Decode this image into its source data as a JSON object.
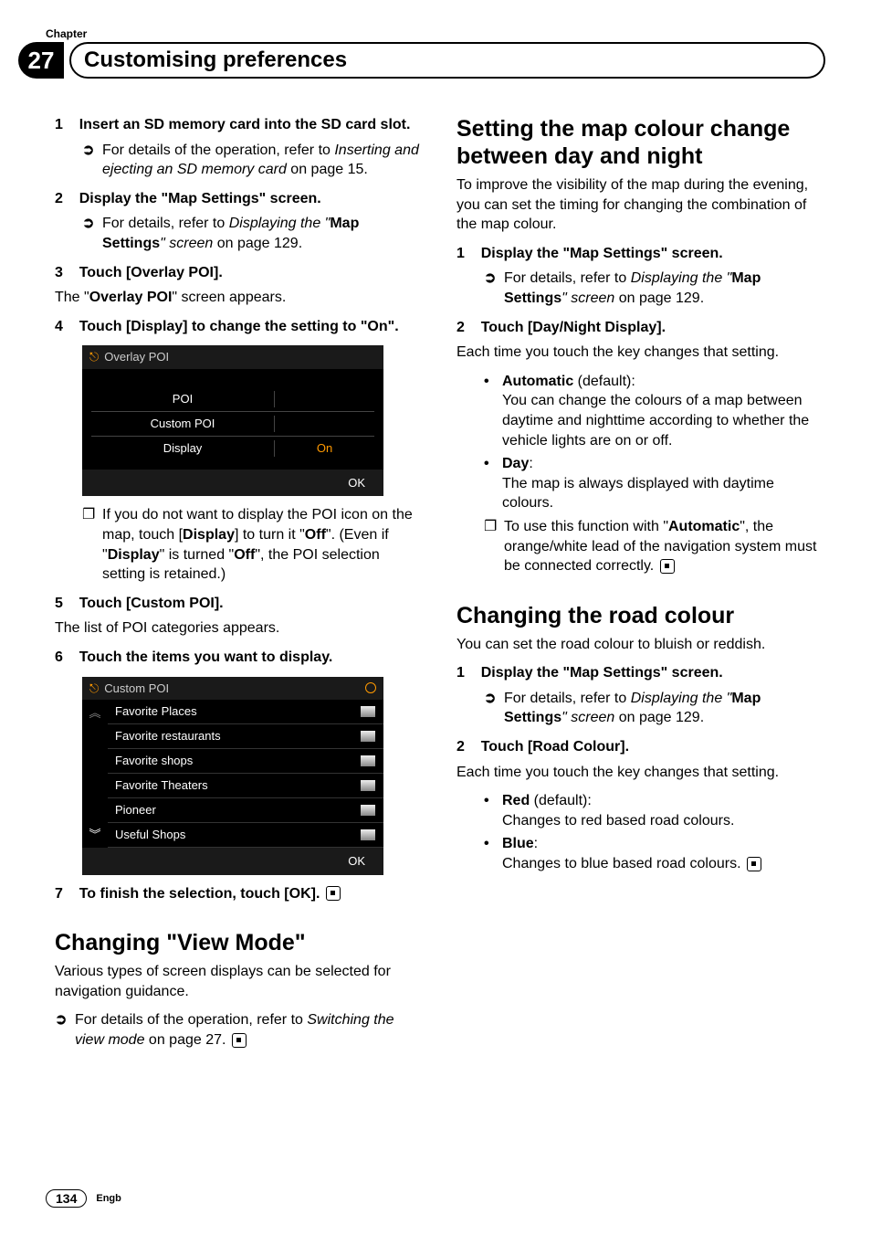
{
  "chapter_label": "Chapter",
  "chapter_number": "27",
  "chapter_title": "Customising preferences",
  "left": {
    "step1_num": "1",
    "step1_title": "Insert an SD memory card into the SD card slot.",
    "step1_note": "For details of the operation, refer to ",
    "step1_note_ital": "Inserting and ejecting an SD memory card",
    "step1_note_tail": " on page 15.",
    "step2_num": "2",
    "step2_title": "Display the \"Map Settings\" screen.",
    "step2_note_a": "For details, refer to ",
    "step2_note_ital": "Displaying the \"",
    "step2_note_bold": "Map Settings",
    "step2_note_ital2": "\" screen",
    "step2_note_tail": " on page 129.",
    "step3_num": "3",
    "step3_title": "Touch [Overlay POI].",
    "step3_body_a": "The \"",
    "step3_body_b": "Overlay POI",
    "step3_body_c": "\" screen appears.",
    "step4_num": "4",
    "step4_title": "Touch [Display] to change the setting to \"On\".",
    "ss1_title": "Overlay POI",
    "ss1_row1": "POI",
    "ss1_row2": "Custom POI",
    "ss1_row3": "Display",
    "ss1_row3_val": "On",
    "ss1_ok": "OK",
    "step4_sq_a": "If you do not want to display the POI icon on the map, touch [",
    "step4_sq_b": "Display",
    "step4_sq_c": "] to turn it \"",
    "step4_sq_d": "Off",
    "step4_sq_e": "\". (Even if \"",
    "step4_sq_f": "Display",
    "step4_sq_g": "\" is turned \"",
    "step4_sq_h": "Off",
    "step4_sq_i": "\", the POI selection setting is retained.)",
    "step5_num": "5",
    "step5_title": "Touch [Custom POI].",
    "step5_body": "The list of POI categories appears.",
    "step6_num": "6",
    "step6_title": "Touch the items you want to display.",
    "ss2_title": "Custom POI",
    "ss2_rows": [
      "Favorite Places",
      "Favorite restaurants",
      "Favorite shops",
      "Favorite Theaters",
      "Pioneer",
      "Useful Shops"
    ],
    "ss2_ok": "OK",
    "step7_num": "7",
    "step7_title": "To finish the selection, touch [OK].",
    "h2_viewmode": "Changing \"View Mode\"",
    "viewmode_p": "Various types of screen displays can be selected for navigation guidance.",
    "viewmode_note": "For details of the operation, refer to ",
    "viewmode_note_ital": "Switching the view mode",
    "viewmode_note_tail": " on page 27."
  },
  "right": {
    "h2_daynight": "Setting the map colour change between day and night",
    "daynight_p": "To improve the visibility of the map during the evening, you can set the timing for changing the combination of the map colour.",
    "dn_step1_num": "1",
    "dn_step1_title": "Display the \"Map Settings\" screen.",
    "dn_step1_note_a": "For details, refer to ",
    "dn_step1_note_ital": "Displaying the \"",
    "dn_step1_note_bold": "Map Settings",
    "dn_step1_note_ital2": "\" screen",
    "dn_step1_note_tail": " on page 129.",
    "dn_step2_num": "2",
    "dn_step2_title": "Touch [Day/Night Display].",
    "dn_step2_body": "Each time you touch the key changes that setting.",
    "dn_b1_label": "Automatic",
    "dn_b1_paren": " (default):",
    "dn_b1_body": "You can change the colours of a map between daytime and nighttime according to whether the vehicle lights are on or off.",
    "dn_b2_label": "Day",
    "dn_b2_colon": ":",
    "dn_b2_body": "The map is always displayed with daytime colours.",
    "dn_sq_a": "To use this function with \"",
    "dn_sq_b": "Automatic",
    "dn_sq_c": "\", the orange/white lead of the navigation system must be connected correctly.",
    "h2_road": "Changing the road colour",
    "road_p": "You can set the road colour to bluish or reddish.",
    "rc_step1_num": "1",
    "rc_step1_title": "Display the \"Map Settings\" screen.",
    "rc_step1_note_a": "For details, refer to ",
    "rc_step1_note_ital": "Displaying the \"",
    "rc_step1_note_bold": "Map Settings",
    "rc_step1_note_ital2": "\" screen",
    "rc_step1_note_tail": " on page 129.",
    "rc_step2_num": "2",
    "rc_step2_title": "Touch [Road Colour].",
    "rc_step2_body": "Each time you touch the key changes that setting.",
    "rc_b1_label": "Red",
    "rc_b1_paren": " (default):",
    "rc_b1_body": "Changes to red based road colours.",
    "rc_b2_label": "Blue",
    "rc_b2_colon": ":",
    "rc_b2_body": "Changes to blue based road colours."
  },
  "footer": {
    "page": "134",
    "lang": "Engb"
  }
}
